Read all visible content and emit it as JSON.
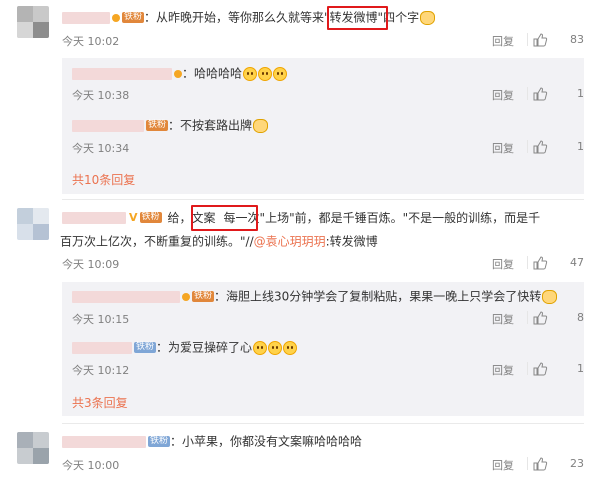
{
  "comments": [
    {
      "badge": "铁粉",
      "text": "：从昨晚开始，等你那么久就等来",
      "highlight": "\"转发微博\"",
      "text_after": "四个字",
      "time": "今天 10:02",
      "reply": "回复",
      "likes": "83",
      "replies": [
        {
          "badge": "",
          "text": "：哈哈哈哈",
          "time": "今天 10:38",
          "reply": "回复",
          "likes": "1"
        },
        {
          "badge": "铁粉",
          "text": "：不按套路出牌",
          "time": "今天 10:34",
          "reply": "回复",
          "likes": "1"
        }
      ],
      "more": "共10条回复"
    },
    {
      "badge": "铁粉",
      "highlight": "给，文案",
      "text_line1": "每一次\"上场\"前，都是千锤百炼。\"不是一般的训练，而是千",
      "text_line2": "百万次上亿次，不断重复的训练。\"//",
      "mention": "@袁心玥玥玥",
      "text_line2_end": ":转发微博",
      "time": "今天 10:09",
      "reply": "回复",
      "likes": "47",
      "replies": [
        {
          "badge": "铁粉",
          "text": "：海胆上线30分钟学会了复制粘贴，果果一晚上只学会了快转",
          "time": "今天 10:15",
          "reply": "回复",
          "likes": "8"
        },
        {
          "badge": "铁粉",
          "text": "：为爱豆操碎了心",
          "time": "今天 10:12",
          "reply": "回复",
          "likes": "1"
        }
      ],
      "more": "共3条回复"
    },
    {
      "badge": "铁粉",
      "text": "：小苹果，你都没有文案嘛哈哈哈哈",
      "time": "今天 10:00",
      "reply": "回复",
      "likes": "23"
    }
  ],
  "icons": {
    "like": "thumbs-up-icon",
    "emoji": "laugh-emoji-icon",
    "cat": "cat-emoji-icon",
    "verified": "verified-v-icon"
  },
  "colors": {
    "badge_iron": "#e1873b",
    "badge_steel": "#7fa6d6",
    "link": "#eb7350",
    "highlight_box": "#e0191b"
  }
}
